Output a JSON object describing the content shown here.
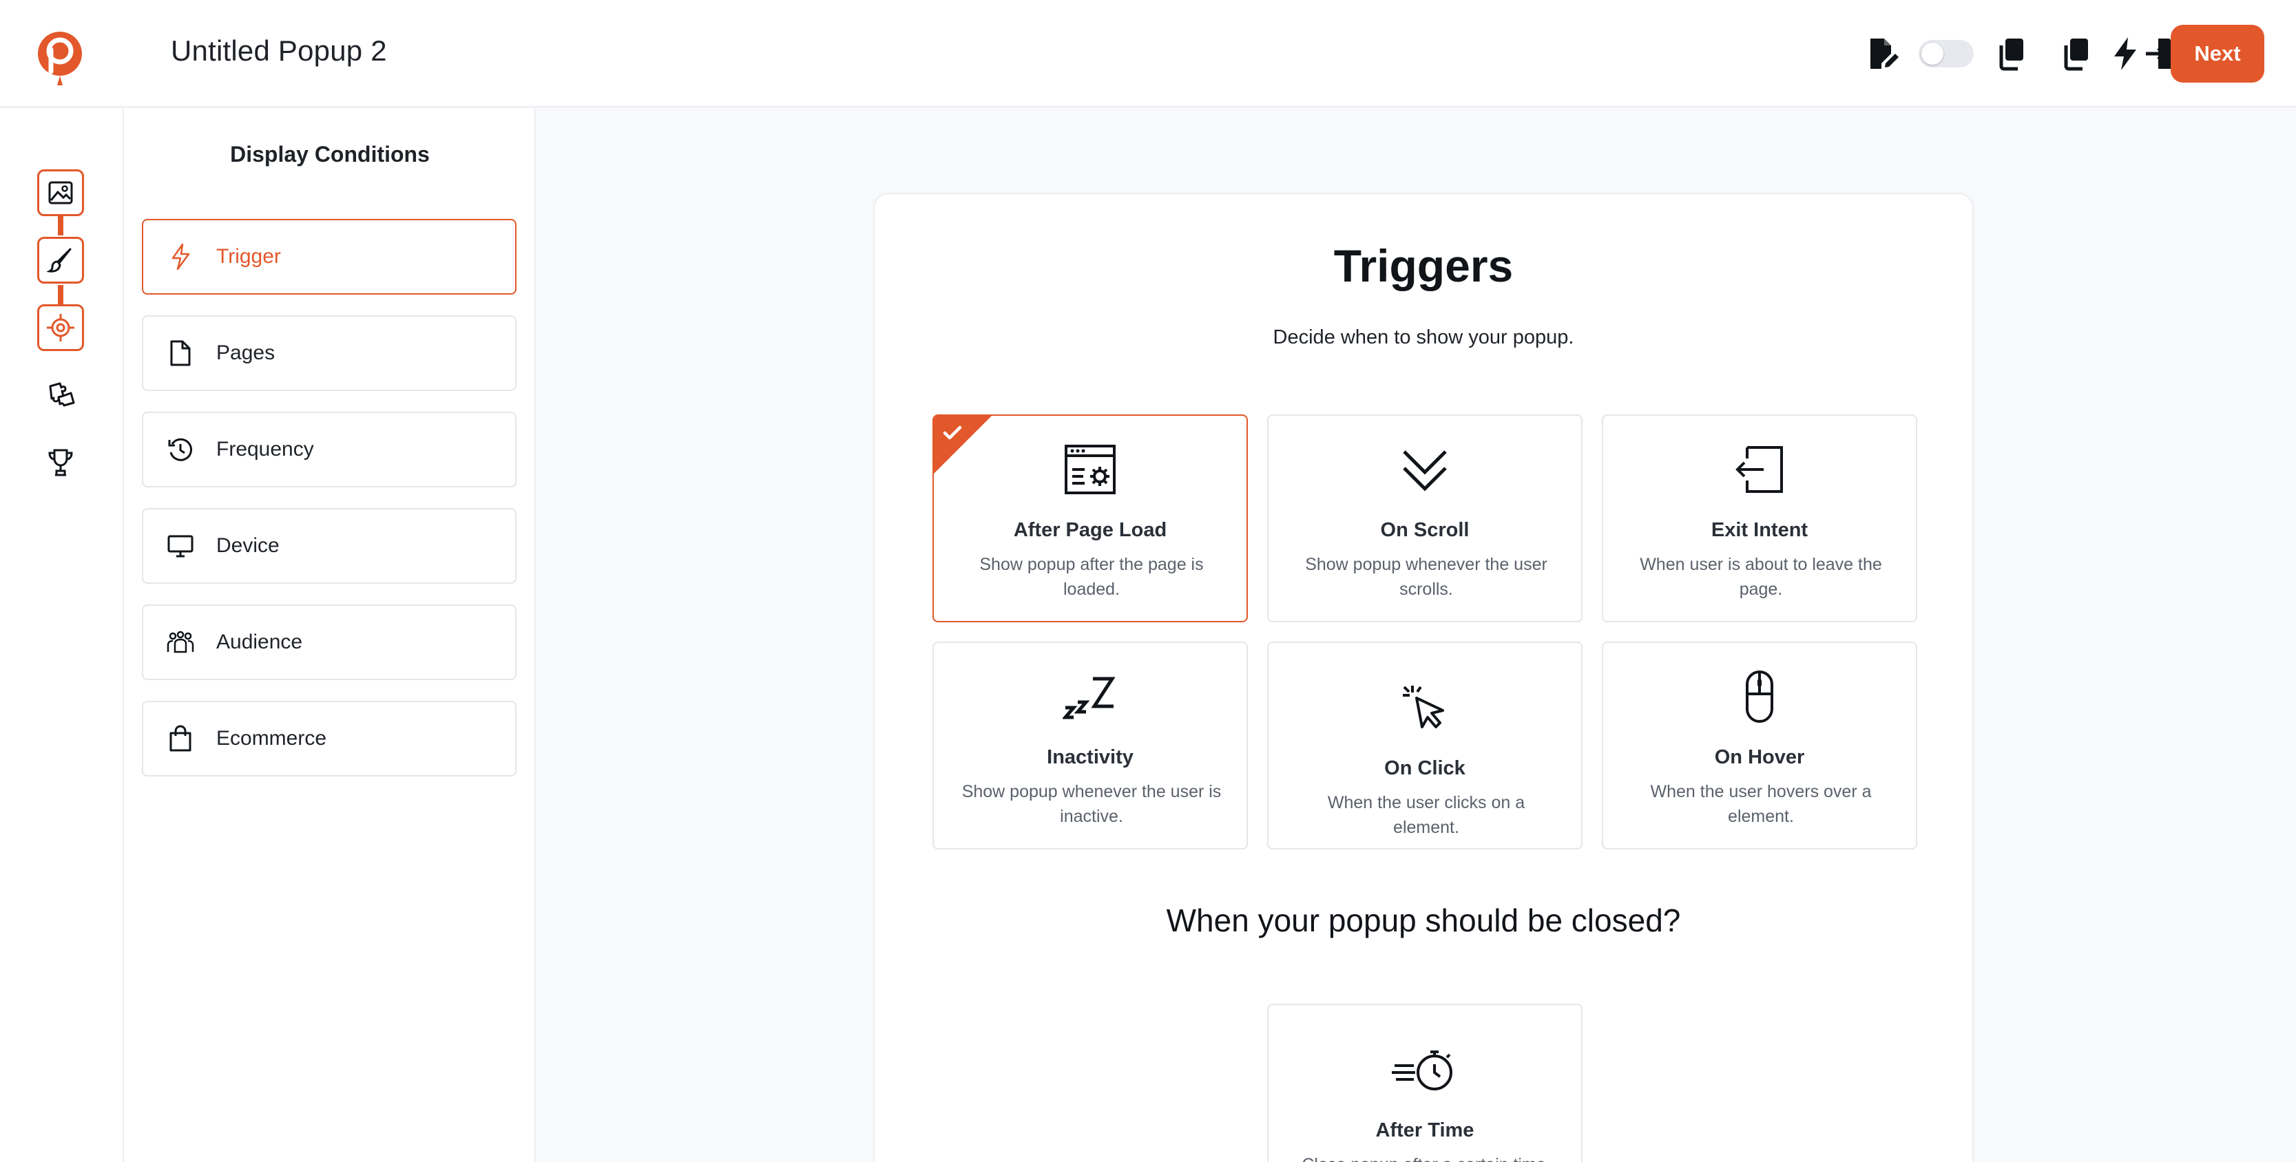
{
  "header": {
    "title": "Untitled Popup 2",
    "next_label": "Next",
    "toggle_on": false
  },
  "colors": {
    "accent": "#e2582b",
    "border": "#e4e6ea",
    "text": "#1f2328",
    "muted": "#5b616b",
    "background": "#f8f9fb"
  },
  "rail": {
    "steps": [
      "image-icon",
      "brush-icon",
      "target-icon"
    ],
    "extra": [
      "puzzle-icon",
      "trophy-icon"
    ]
  },
  "panel": {
    "title": "Display Conditions",
    "items": [
      {
        "label": "Trigger",
        "icon": "bolt-icon",
        "active": true
      },
      {
        "label": "Pages",
        "icon": "file-icon",
        "active": false
      },
      {
        "label": "Frequency",
        "icon": "clock-refresh-icon",
        "active": false
      },
      {
        "label": "Device",
        "icon": "monitor-icon",
        "active": false
      },
      {
        "label": "Audience",
        "icon": "people-icon",
        "active": false
      },
      {
        "label": "Ecommerce",
        "icon": "shopping-bag-icon",
        "active": false
      }
    ]
  },
  "main": {
    "title": "Triggers",
    "subtitle": "Decide when to show your popup.",
    "triggers": [
      {
        "title": "After Page Load",
        "desc": "Show popup after the page is loaded.",
        "icon": "page-settings-icon",
        "selected": true
      },
      {
        "title": "On Scroll",
        "desc": "Show popup whenever the user scrolls.",
        "icon": "double-chevron-down-icon",
        "selected": false
      },
      {
        "title": "Exit Intent",
        "desc": "When user is about to leave the page.",
        "icon": "exit-icon",
        "selected": false
      },
      {
        "title": "Inactivity",
        "desc": "Show popup whenever the user is inactive.",
        "icon": "sleep-icon",
        "selected": false
      },
      {
        "title": "On Click",
        "desc": "When the user clicks on a element.",
        "icon": "cursor-click-icon",
        "selected": false
      },
      {
        "title": "On Hover",
        "desc": "When the user hovers over a element.",
        "icon": "mouse-icon",
        "selected": false
      }
    ],
    "close_heading": "When your popup should be closed?",
    "close_options": [
      {
        "title": "After Time",
        "desc": "Close popup after a certain time.",
        "icon": "stopwatch-icon"
      }
    ]
  }
}
